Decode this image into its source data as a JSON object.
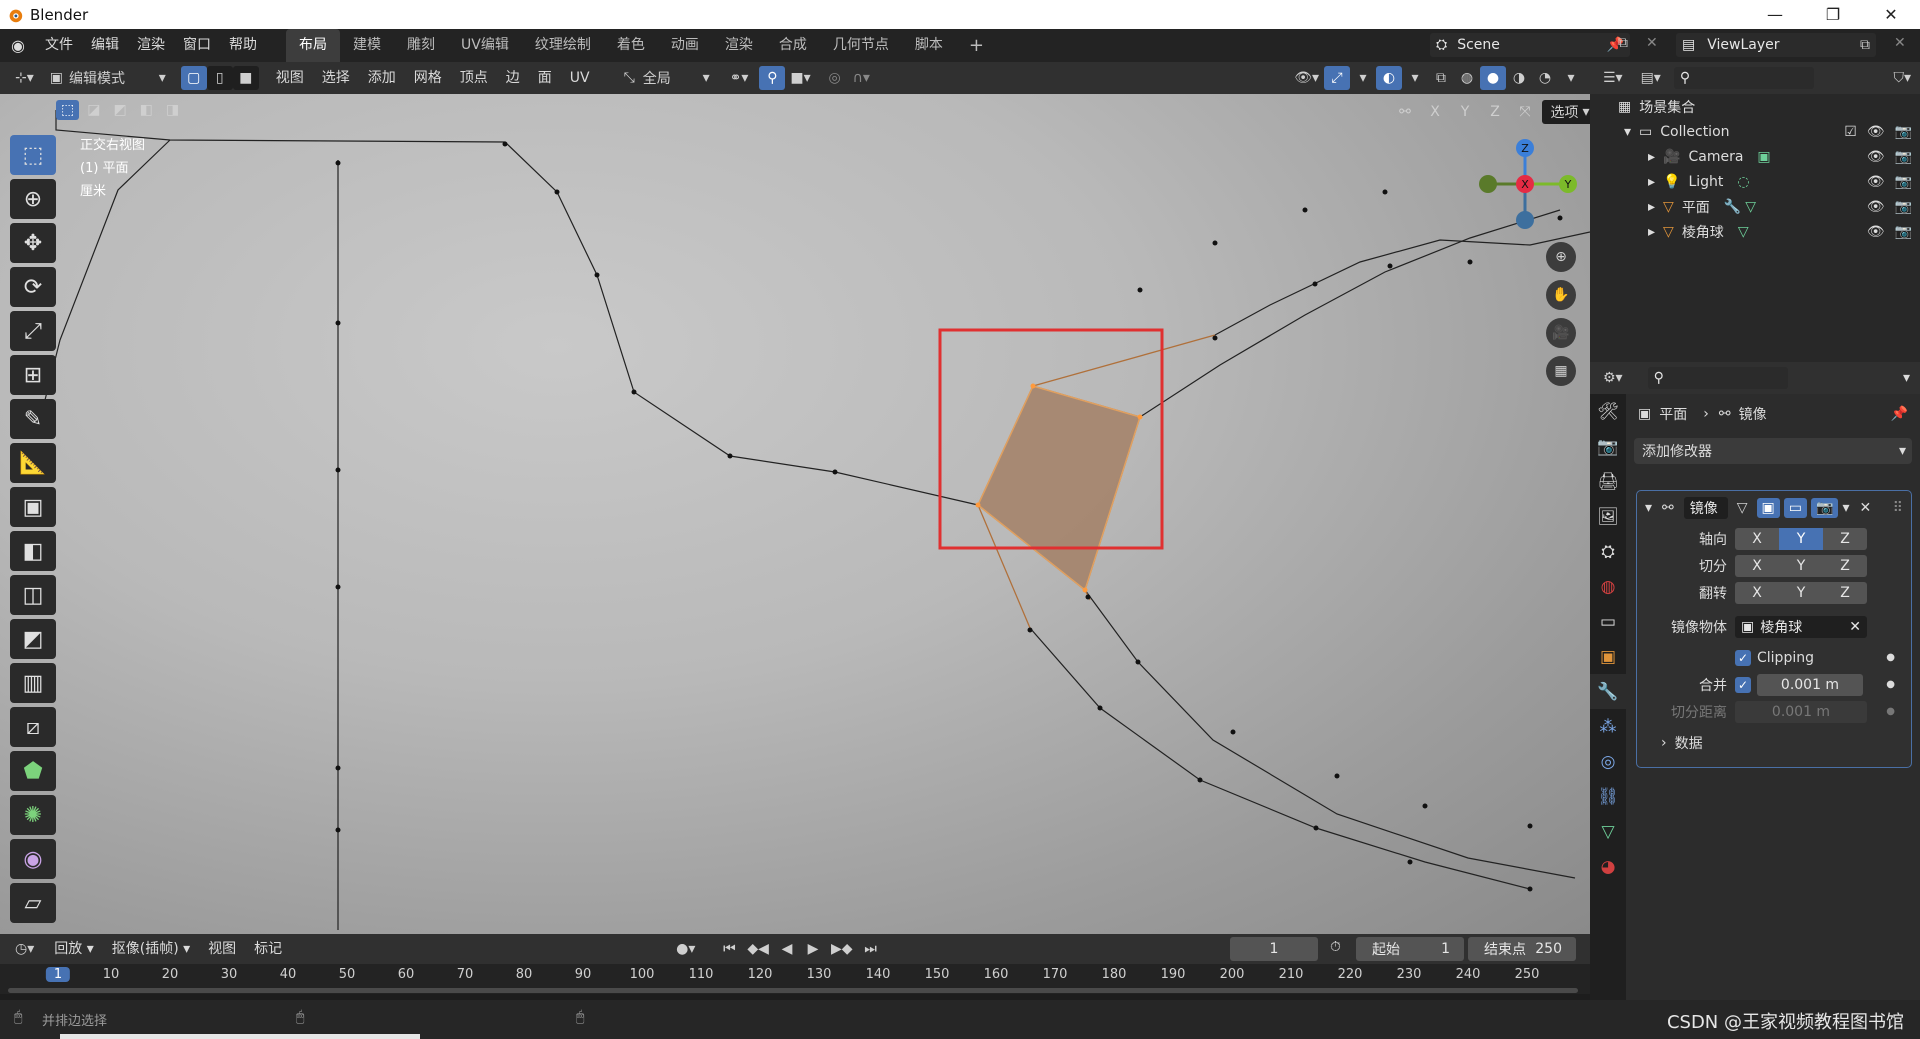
{
  "window": {
    "title": "Blender"
  },
  "menus": [
    "文件",
    "编辑",
    "渲染",
    "窗口",
    "帮助"
  ],
  "workspaces": [
    "布局",
    "建模",
    "雕刻",
    "UV编辑",
    "纹理绘制",
    "着色",
    "动画",
    "渲染",
    "合成",
    "几何节点",
    "脚本"
  ],
  "scene": {
    "label": "Scene",
    "viewlayer": "ViewLayer"
  },
  "viewport_header": {
    "mode": "编辑模式",
    "menus": [
      "视图",
      "选择",
      "添加",
      "网格",
      "顶点",
      "边",
      "面",
      "UV"
    ],
    "orientation": "全局",
    "axes": [
      "X",
      "Y",
      "Z"
    ],
    "options": "选项"
  },
  "viewport_info": {
    "view": "正交右视图",
    "object": "(1) 平面",
    "unit": "厘米"
  },
  "gizmo": {
    "z": "Z",
    "x": "X",
    "y": "Y"
  },
  "outliner": {
    "root": "场景集合",
    "collection": "Collection",
    "items": [
      {
        "name": "Camera",
        "icon": "camera-icon"
      },
      {
        "name": "Light",
        "icon": "light-icon"
      },
      {
        "name": "平面",
        "icon": "mesh-icon"
      },
      {
        "name": "棱角球",
        "icon": "mesh-icon"
      }
    ]
  },
  "properties": {
    "breadcrumb_object": "平面",
    "breadcrumb_modifier": "镜像",
    "add_modifier": "添加修改器",
    "modifier_name": "镜像",
    "axis_label": "轴向",
    "bisect_label": "切分",
    "flip_label": "翻转",
    "axes": [
      "X",
      "Y",
      "Z"
    ],
    "mirror_object_label": "镜像物体",
    "mirror_object_value": "棱角球",
    "clipping_label": "Clipping",
    "merge_label": "合并",
    "merge_value": "0.001 m",
    "bisect_distance_label": "切分距离",
    "bisect_distance_value": "0.001 m",
    "data_label": "数据"
  },
  "timeline": {
    "playback": "回放",
    "keying": "抠像(插帧)",
    "view": "视图",
    "marker": "标记",
    "current_frame": "1",
    "start_label": "起始",
    "start_value": "1",
    "end_label": "结束点",
    "end_value": "250",
    "ruler": [
      "1",
      "10",
      "20",
      "30",
      "40",
      "50",
      "60",
      "70",
      "80",
      "90",
      "100",
      "110",
      "120",
      "130",
      "140",
      "150",
      "160",
      "170",
      "180",
      "190",
      "200",
      "210",
      "220",
      "230",
      "240",
      "250"
    ]
  },
  "status": {
    "hint": "并排边选择",
    "watermark": "CSDN @王家视频教程图书馆"
  },
  "colors": {
    "accent": "#4772b3",
    "highlight_box": "#e03030",
    "selected_face": "#a38066"
  }
}
